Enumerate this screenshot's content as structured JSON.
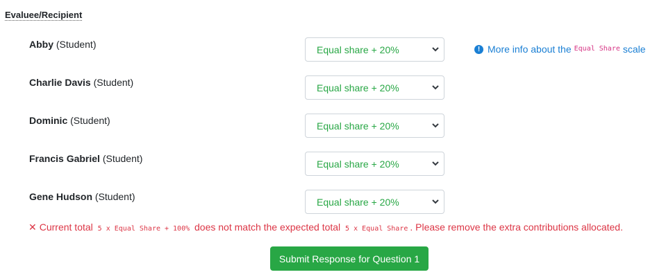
{
  "section": {
    "header": "Evaluee/Recipient"
  },
  "rows": [
    {
      "name": "Abby",
      "role": "(Student)",
      "selected": "Equal share + 20%"
    },
    {
      "name": "Charlie Davis",
      "role": "(Student)",
      "selected": "Equal share + 20%"
    },
    {
      "name": "Dominic",
      "role": "(Student)",
      "selected": "Equal share + 20%"
    },
    {
      "name": "Francis Gabriel",
      "role": "(Student)",
      "selected": "Equal share + 20%"
    },
    {
      "name": "Gene Hudson",
      "role": "(Student)",
      "selected": "Equal share + 20%"
    }
  ],
  "info_link": {
    "icon": "info-circle-icon",
    "prefix": "More info about the",
    "code": "Equal Share",
    "suffix": "scale"
  },
  "error": {
    "icon": "x-mark-icon",
    "symbol": "✕",
    "part1": "Current total",
    "code1": "5 x Equal Share + 100%",
    "part2": "does not match the expected total",
    "code2": "5 x Equal Share",
    "part3": ". Please remove the extra contributions allocated."
  },
  "submit_label": "Submit Response for Question 1",
  "colors": {
    "select_text": "#28a745",
    "link": "#1a7fd4",
    "error": "#dc3545",
    "button_bg": "#28a745",
    "code_pink": "#d63384"
  }
}
